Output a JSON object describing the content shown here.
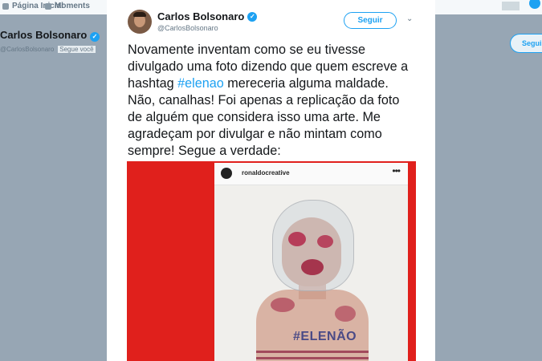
{
  "background": {
    "nav": [
      {
        "label": "Página Inicial",
        "icon": "home-icon"
      },
      {
        "label": "Moments",
        "icon": "lightning-icon"
      }
    ],
    "profile_name": "Carlos Bolsonaro",
    "profile_handle": "@CarlosBolsonaro",
    "follows_you": "Segue você",
    "follow_label": "Seguir"
  },
  "tweet": {
    "author_name": "Carlos Bolsonaro",
    "author_handle": "@CarlosBolsonaro",
    "follow_label": "Seguir",
    "text_before": "Novamente inventam como se eu tivesse divulgado uma foto dizendo que quem escreve a hashtag ",
    "hashtag": "#elenao",
    "text_after": " mereceria alguma maldade. Não, canalhas! Foi apenas a replicação da foto de alguém que considera isso uma arte. Me agradeçam por divulgar e não mintam como sempre! Segue a verdade:"
  },
  "media": {
    "instagram_user": "ronaldocreative",
    "more_glyph": "•••",
    "chest_text": "#ELENÃO"
  },
  "colors": {
    "accent": "#1da1f2",
    "media_background": "#e0201c"
  }
}
